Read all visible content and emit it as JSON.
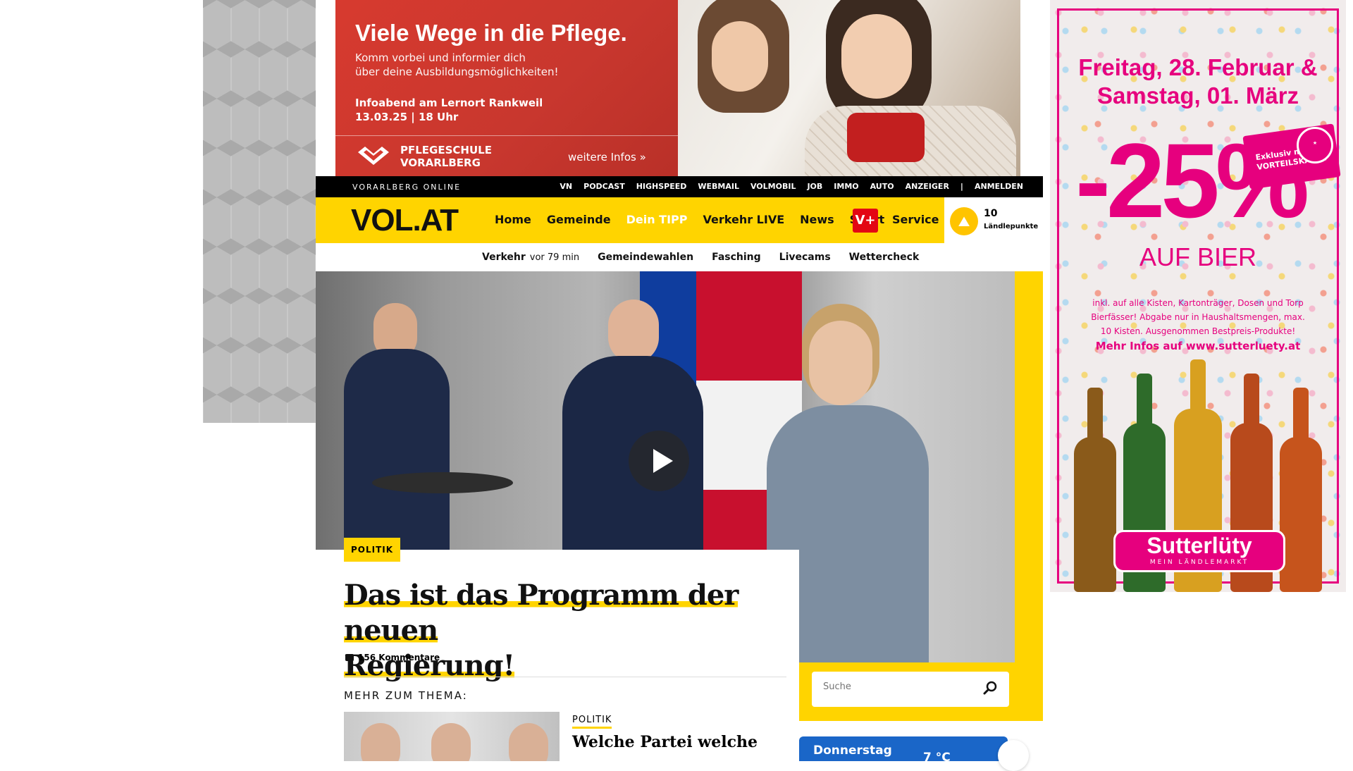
{
  "banner": {
    "title": "Viele Wege in die Pflege.",
    "subtitle_line1": "Komm vorbei und informier dich",
    "subtitle_line2": "über deine Ausbildungsmöglichkeiten!",
    "event_line1": "Infoabend am Lernort Rankweil",
    "event_line2": "13.03.25 | 18 Uhr",
    "logo_line1": "PFLEGESCHULE",
    "logo_line2": "VORARLBERG",
    "more_link": "weitere Infos »"
  },
  "skyscraper": {
    "date_line1": "Freitag, 28. Februar &",
    "date_line2": "Samstag, 01. März",
    "discount": "-25%",
    "badge_line1": "Exklusiv mit",
    "badge_line2": "VORTEILSKARTE",
    "product": "AUF BIER",
    "fine_print": "inkl. auf alle Kisten, Kartonträger, Dosen und Torp Bierfässer! Abgabe nur in Haushaltsmengen, max. 10 Kisten. Ausgenommen Bestpreis-Produkte!",
    "url_text": "Mehr Infos auf www.sutterluety.at",
    "brand": "Sutterlüty",
    "brand_sub": "MEIN LÄNDLEMARKT",
    "colors": {
      "accent": "#e6007e"
    }
  },
  "topbar": {
    "brand": "VORARLBERG ONLINE",
    "links": [
      "VN",
      "PODCAST",
      "HIGHSPEED",
      "WEBMAIL",
      "VOLMOBIL",
      "JOB",
      "IMMO",
      "AUTO",
      "ANZEIGER",
      "|",
      "ANMELDEN"
    ]
  },
  "nav": {
    "logo": "VOL.AT",
    "items": [
      "Home",
      "Gemeinde",
      "Dein TIPP",
      "Verkehr LIVE",
      "News",
      "Sport"
    ],
    "vplus": "V+",
    "service": "Service",
    "points_value": "10",
    "points_label": "Ländlepunkte",
    "colors": {
      "brand_yellow": "#ffd400",
      "vplus_red": "#e30613"
    }
  },
  "subnav": {
    "traffic_label": "Verkehr",
    "traffic_time": "vor 79 min",
    "items": [
      "Gemeindewahlen",
      "Fasching",
      "Livecams",
      "Wettercheck"
    ]
  },
  "article": {
    "category": "POLITIK",
    "headline_line1": "Das ist das Programm der neuen",
    "headline_line2": "Regierung!",
    "comments": "156 Kommentare",
    "more_label": "MEHR ZUM THEMA:",
    "related_category": "POLITIK",
    "related_title": "Welche Partei welche"
  },
  "search": {
    "placeholder": "Suche"
  },
  "weather": {
    "day": "Donnerstag",
    "temp": "7 °C"
  }
}
